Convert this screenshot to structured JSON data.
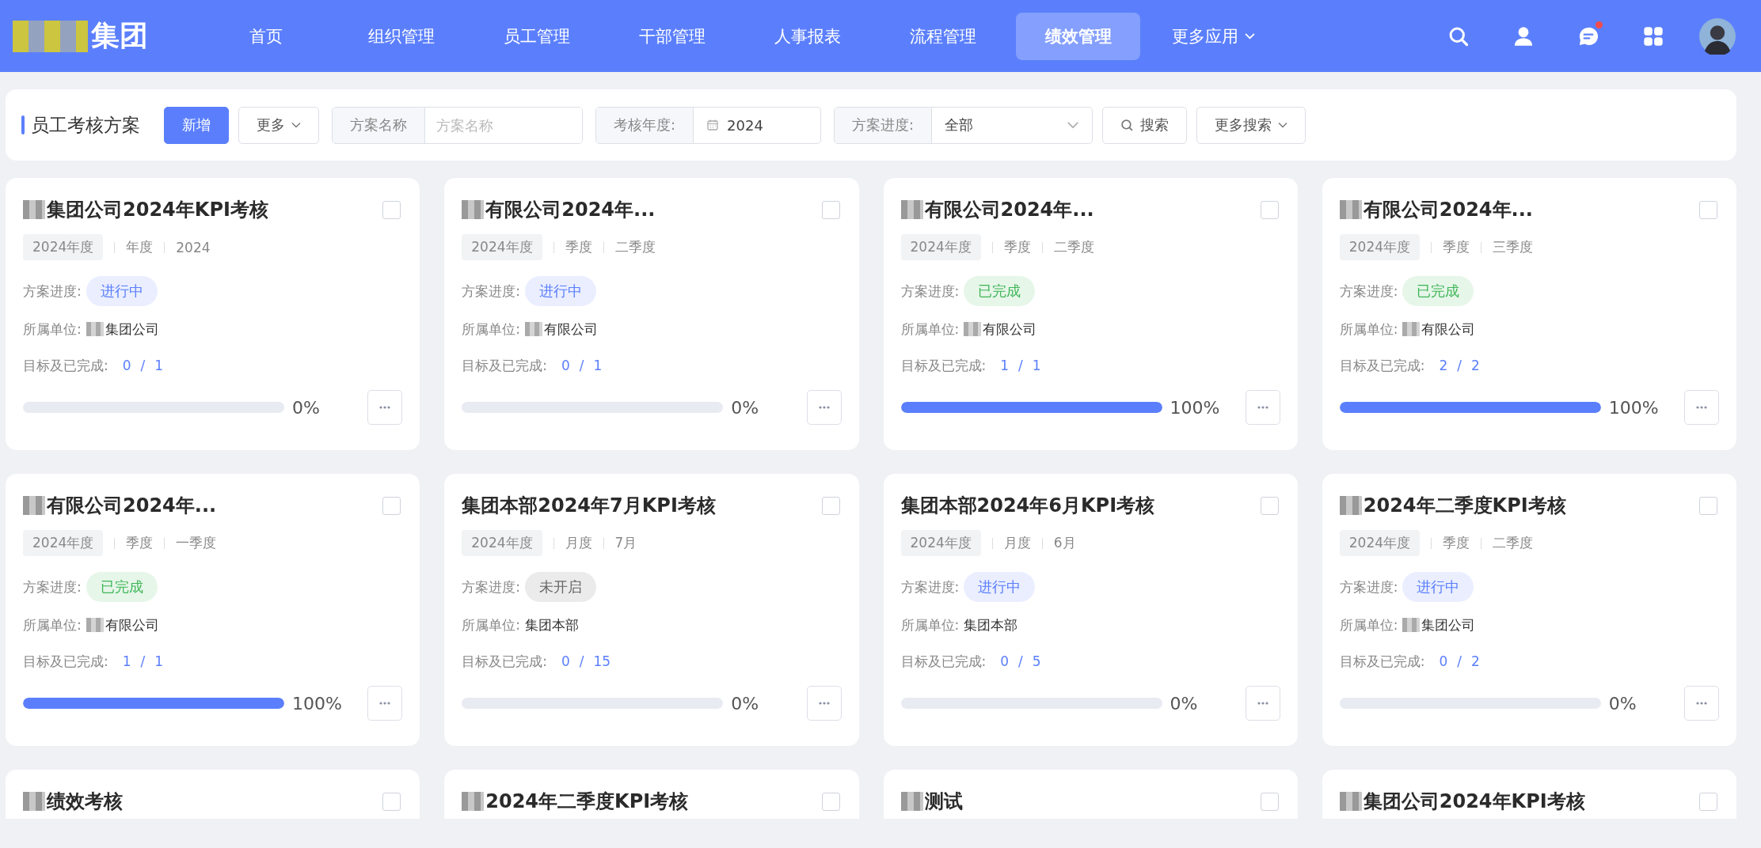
{
  "header": {
    "logo_text": "集团",
    "nav": [
      {
        "label": "首页",
        "selected": false,
        "dropdown": false
      },
      {
        "label": "组织管理",
        "selected": false,
        "dropdown": false
      },
      {
        "label": "员工管理",
        "selected": false,
        "dropdown": false
      },
      {
        "label": "干部管理",
        "selected": false,
        "dropdown": false
      },
      {
        "label": "人事报表",
        "selected": false,
        "dropdown": false
      },
      {
        "label": "流程管理",
        "selected": false,
        "dropdown": false
      },
      {
        "label": "绩效管理",
        "selected": true,
        "dropdown": false
      },
      {
        "label": "更多应用",
        "selected": false,
        "dropdown": true
      }
    ],
    "notification_dot": true
  },
  "toolbar": {
    "title": "员工考核方案",
    "add_button": "新增",
    "more_button": "更多",
    "name_filter": {
      "label": "方案名称",
      "placeholder": "方案名称"
    },
    "year_filter": {
      "label": "考核年度:",
      "value": "2024"
    },
    "progress_filter": {
      "label": "方案进度:",
      "value": "全部"
    },
    "search_button": "搜索",
    "more_search_button": "更多搜索"
  },
  "cards": [
    {
      "redacted": true,
      "title": "集团公司2024年KPI考核",
      "checked": false,
      "year_tag": "2024年度",
      "period": "年度",
      "period_value": "2024",
      "progress_label": "方案进度:",
      "status": "进行中",
      "color": "#5b7ffc",
      "unit_label": "所属单位:",
      "unit_redacted": true,
      "unit": "集团公司",
      "goal_label": "目标及已完成:",
      "goal_total": "0",
      "goal_done": "1",
      "goal_sep": "/",
      "level": 0,
      "percent": "0%"
    },
    {
      "redacted": true,
      "title": "有限公司2024年...",
      "checked": false,
      "year_tag": "2024年度",
      "period": "季度",
      "period_value": "二季度",
      "progress_label": "方案进度:",
      "status": "进行中",
      "color": "#5b7ffc",
      "unit_label": "所属单位:",
      "unit_redacted": true,
      "unit": "有限公司",
      "goal_label": "目标及已完成:",
      "goal_total": "0",
      "goal_done": "1",
      "goal_sep": "/",
      "level": 0,
      "percent": "0%"
    },
    {
      "redacted": true,
      "title": "有限公司2024年...",
      "checked": false,
      "year_tag": "2024年度",
      "period": "季度",
      "period_value": "二季度",
      "progress_label": "方案进度:",
      "status": "已完成",
      "color": "#3fb658",
      "unit_label": "所属单位:",
      "unit_redacted": true,
      "unit": "有限公司",
      "goal_label": "目标及已完成:",
      "goal_total": "1",
      "goal_done": "1",
      "goal_sep": "/",
      "level": 1,
      "percent": "100%"
    },
    {
      "redacted": true,
      "title": "有限公司2024年...",
      "checked": false,
      "year_tag": "2024年度",
      "period": "季度",
      "period_value": "三季度",
      "progress_label": "方案进度:",
      "status": "已完成",
      "color": "#3fb658",
      "unit_label": "所属单位:",
      "unit_redacted": true,
      "unit": "有限公司",
      "goal_label": "目标及已完成:",
      "goal_total": "2",
      "goal_done": "2",
      "goal_sep": "/",
      "level": 1,
      "percent": "100%"
    },
    {
      "redacted": true,
      "title": "有限公司2024年...",
      "checked": false,
      "year_tag": "2024年度",
      "period": "季度",
      "period_value": "一季度",
      "progress_label": "方案进度:",
      "status": "已完成",
      "color": "#3fb658",
      "unit_label": "所属单位:",
      "unit_redacted": true,
      "unit": "有限公司",
      "goal_label": "目标及已完成:",
      "goal_total": "1",
      "goal_done": "1",
      "goal_sep": "/",
      "level": 1,
      "percent": "100%"
    },
    {
      "redacted": false,
      "title": "集团本部2024年7月KPI考核",
      "checked": false,
      "year_tag": "2024年度",
      "period": "月度",
      "period_value": "7月",
      "progress_label": "方案进度:",
      "status": "未开启",
      "color": "#666666",
      "unit_label": "所属单位:",
      "unit_redacted": false,
      "unit": "集团本部",
      "goal_label": "目标及已完成:",
      "goal_total": "0",
      "goal_done": "15",
      "goal_sep": "/",
      "level": 0,
      "percent": "0%"
    },
    {
      "redacted": false,
      "title": "集团本部2024年6月KPI考核",
      "checked": false,
      "year_tag": "2024年度",
      "period": "月度",
      "period_value": "6月",
      "progress_label": "方案进度:",
      "status": "进行中",
      "color": "#5b7ffc",
      "unit_label": "所属单位:",
      "unit_redacted": false,
      "unit": "集团本部",
      "goal_label": "目标及已完成:",
      "goal_total": "0",
      "goal_done": "5",
      "goal_sep": "/",
      "level": 0,
      "percent": "0%"
    },
    {
      "redacted": true,
      "title": "2024年二季度KPI考核",
      "checked": false,
      "year_tag": "2024年度",
      "period": "季度",
      "period_value": "二季度",
      "progress_label": "方案进度:",
      "status": "进行中",
      "color": "#5b7ffc",
      "unit_label": "所属单位:",
      "unit_redacted": true,
      "unit": "集团公司",
      "goal_label": "目标及已完成:",
      "goal_total": "0",
      "goal_done": "2",
      "goal_sep": "/",
      "level": 0,
      "percent": "0%"
    },
    {
      "redacted": true,
      "title": "绩效考核",
      "checked": false
    },
    {
      "redacted": true,
      "title": "2024年二季度KPI考核",
      "checked": false
    },
    {
      "redacted": true,
      "title": "测试",
      "checked": false
    },
    {
      "redacted": true,
      "title": "集团公司2024年KPI考核",
      "checked": false
    }
  ]
}
